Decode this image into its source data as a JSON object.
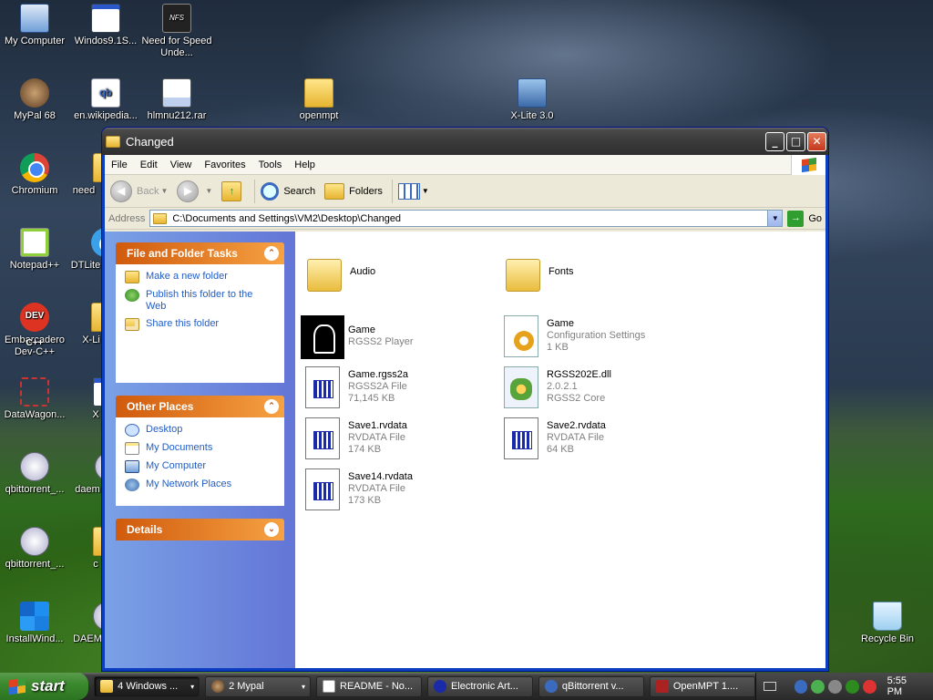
{
  "desktop": {
    "icons": [
      {
        "label": "My Computer",
        "icon": "computer-icon"
      },
      {
        "label": "Windos9.1S...",
        "icon": "window-icon"
      },
      {
        "label": "Need for Speed Unde...",
        "icon": "nfs-icon"
      },
      {
        "label": "MyPal 68",
        "icon": "mypal-icon"
      },
      {
        "label": "en.wikipedia...",
        "icon": "qbittorrent-file-icon"
      },
      {
        "label": "hlmnu212.rar",
        "icon": "rar-icon"
      },
      {
        "label": "openmpt",
        "icon": "folder-icon"
      },
      {
        "label": "X-Lite 3.0",
        "icon": "xlite-icon"
      },
      {
        "label": "Chromium",
        "icon": "chromium-icon"
      },
      {
        "label": "need",
        "icon": "folder-icon"
      },
      {
        "label": "Notepad++",
        "icon": "notepadpp-icon"
      },
      {
        "label": "DTLite",
        "icon": "dtlite-icon"
      },
      {
        "label": "Embarcadero Dev-C++",
        "icon": "devcpp-icon"
      },
      {
        "label": "X-Li",
        "icon": "folder-icon"
      },
      {
        "label": "DataWagon...",
        "icon": "datawagon-icon"
      },
      {
        "label": "X",
        "icon": "shortcut-icon"
      },
      {
        "label": "qbittorrent_...",
        "icon": "qbittorrent-icon"
      },
      {
        "label": "daem",
        "icon": "daemon-icon"
      },
      {
        "label": "qbittorrent_...",
        "icon": "qbittorrent-icon"
      },
      {
        "label": "c",
        "icon": "folder-icon"
      },
      {
        "label": "InstallWind...",
        "icon": "windows-logo-icon"
      },
      {
        "label": "DAEM",
        "icon": "daemon-icon"
      },
      {
        "label": "Recycle Bin",
        "icon": "recycle-bin-icon"
      }
    ],
    "nfs_badge": "NFS",
    "devcpp_badge": "DEV C++",
    "qb_badge": "qb"
  },
  "window": {
    "title": "Changed",
    "buttons": {
      "minimize": "_",
      "maximize": "□",
      "close": "✕"
    },
    "menu": [
      "File",
      "Edit",
      "View",
      "Favorites",
      "Tools",
      "Help"
    ],
    "toolbar": {
      "back": "Back",
      "search": "Search",
      "folders": "Folders"
    },
    "address": {
      "label": "Address",
      "path": "C:\\Documents and Settings\\VM2\\Desktop\\Changed",
      "go": "Go"
    },
    "left_panels": [
      {
        "title": "File and Folder Tasks",
        "links": [
          {
            "label": "Make a new folder",
            "icon": "new-folder-icon"
          },
          {
            "label": "Publish this folder to the Web",
            "icon": "publish-web-icon"
          },
          {
            "label": "Share this folder",
            "icon": "share-folder-icon"
          }
        ]
      },
      {
        "title": "Other Places",
        "links": [
          {
            "label": "Desktop",
            "icon": "desktop-icon"
          },
          {
            "label": "My Documents",
            "icon": "my-documents-icon"
          },
          {
            "label": "My Computer",
            "icon": "my-computer-icon"
          },
          {
            "label": "My Network Places",
            "icon": "network-places-icon"
          }
        ]
      },
      {
        "title": "Details",
        "links": []
      }
    ],
    "files": [
      {
        "name": "Audio",
        "lines": [],
        "icon": "folder-icon"
      },
      {
        "name": "Fonts",
        "lines": [],
        "icon": "folder-icon"
      },
      {
        "name": "Game",
        "lines": [
          "RGSS2 Player"
        ],
        "icon": "game-exe-icon"
      },
      {
        "name": "Game",
        "lines": [
          "Configuration Settings",
          "1 KB"
        ],
        "icon": "config-settings-icon"
      },
      {
        "name": "Game.rgss2a",
        "lines": [
          "RGSS2A File",
          "71,145 KB"
        ],
        "icon": "generic-file-icon"
      },
      {
        "name": "RGSS202E.dll",
        "lines": [
          "2.0.2.1",
          "RGSS2 Core"
        ],
        "icon": "dll-icon"
      },
      {
        "name": "Save1.rvdata",
        "lines": [
          "RVDATA File",
          "174 KB"
        ],
        "icon": "generic-file-icon"
      },
      {
        "name": "Save2.rvdata",
        "lines": [
          "RVDATA File",
          "64 KB"
        ],
        "icon": "generic-file-icon"
      },
      {
        "name": "Save14.rvdata",
        "lines": [
          "RVDATA File",
          "173 KB"
        ],
        "icon": "generic-file-icon"
      }
    ]
  },
  "taskbar": {
    "start": "start",
    "tasks": [
      {
        "label": "4 Windows ...",
        "icon": "folder-icon",
        "caret": "▾",
        "active": true
      },
      {
        "label": "2 Mypal",
        "icon": "mypal-icon",
        "caret": "▾",
        "active": false
      },
      {
        "label": "README - No...",
        "icon": "notepad-icon",
        "caret": "",
        "active": false
      },
      {
        "label": "Electronic Art...",
        "icon": "ea-icon",
        "caret": "",
        "active": false
      },
      {
        "label": "qBittorrent v...",
        "icon": "qbittorrent-icon",
        "caret": "",
        "active": false
      },
      {
        "label": "OpenMPT 1....",
        "icon": "openmpt-icon",
        "caret": "",
        "active": false
      }
    ],
    "clock": "5:55 PM"
  }
}
